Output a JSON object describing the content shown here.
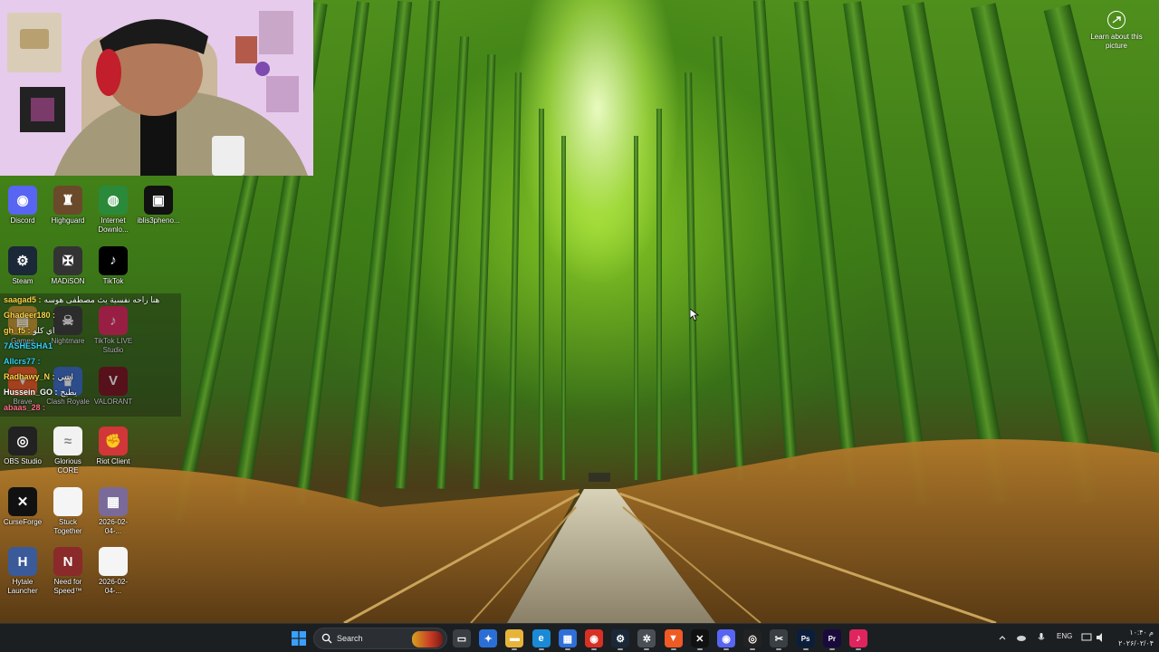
{
  "spotlight": {
    "label": "Learn about this picture"
  },
  "desktop": {
    "icons": [
      {
        "label": "Discord",
        "icon": "discord-icon",
        "color": "#5865f2",
        "glyph": "◉"
      },
      {
        "label": "Highguard",
        "icon": "highguard-icon",
        "color": "#6a4a2a",
        "glyph": "♜"
      },
      {
        "label": "Internet Downlo...",
        "icon": "internet-download-manager-icon",
        "color": "#2a8a3a",
        "glyph": "◍"
      },
      {
        "label": "iblis3pheno...",
        "icon": "file-thumbnail-icon",
        "color": "#111111",
        "glyph": "▣"
      },
      {
        "label": "Steam",
        "icon": "steam-icon",
        "color": "#1b2838",
        "glyph": "⚙"
      },
      {
        "label": "MADiSON",
        "icon": "madison-icon",
        "color": "#333333",
        "glyph": "✠"
      },
      {
        "label": "TikTok",
        "icon": "tiktok-icon",
        "color": "#000000",
        "glyph": "♪"
      },
      {
        "label": "Games",
        "icon": "games-folder-icon",
        "color": "#c79a2e",
        "glyph": "▤"
      },
      {
        "label": "Nightmare",
        "icon": "nightmare-icon",
        "color": "#3a3a3a",
        "glyph": "☠"
      },
      {
        "label": "TikTok LIVE Studio",
        "icon": "tiktok-live-studio-icon",
        "color": "#e0245e",
        "glyph": "♪"
      },
      {
        "label": "Brave",
        "icon": "brave-icon",
        "color": "#f05a24",
        "glyph": "▼"
      },
      {
        "label": "Clash Royale",
        "icon": "clash-royale-icon",
        "color": "#3a6bc9",
        "glyph": "♛"
      },
      {
        "label": "VALORANT",
        "icon": "valorant-icon",
        "color": "#7a1020",
        "glyph": "V"
      },
      {
        "label": "OBS Studio",
        "icon": "obs-studio-icon",
        "color": "#222222",
        "glyph": "◎"
      },
      {
        "label": "Glorious CORE",
        "icon": "glorious-core-icon",
        "color": "#f2f2f2",
        "glyph": "≈"
      },
      {
        "label": "Riot Client",
        "icon": "riot-client-icon",
        "color": "#d13639",
        "glyph": "✊"
      },
      {
        "label": "CurseForge",
        "icon": "curseforge-icon",
        "color": "#111111",
        "glyph": "✕"
      },
      {
        "label": "Stuck Together",
        "icon": "document-icon",
        "color": "#f5f5f5",
        "glyph": ""
      },
      {
        "label": "2026-02-04-...",
        "icon": "image-thumbnail-icon",
        "color": "#7a6a9a",
        "glyph": "▦"
      },
      {
        "label": "Hytale Launcher",
        "icon": "hytale-launcher-icon",
        "color": "#3a5a9a",
        "glyph": "H"
      },
      {
        "label": "Need for Speed™ Mo...",
        "icon": "need-for-speed-icon",
        "color": "#8a2a2a",
        "glyph": "N"
      },
      {
        "label": "2026-02-04-...",
        "icon": "document-icon",
        "color": "#f5f5f5",
        "glyph": ""
      }
    ]
  },
  "chat": [
    {
      "user": "saagad5 :",
      "message": "هنا راحه نفسية يث مصطفى هوسه",
      "color": "#ffd84a"
    },
    {
      "user": "Ghadeer180 :",
      "message": "",
      "color": "#ffd84a"
    },
    {
      "user": "gh_f5 :",
      "message": "اي كلو",
      "color": "#ffd84a"
    },
    {
      "user": "7ASHESHA1",
      "message": "",
      "color": "#35d3ff"
    },
    {
      "user": "Allcrs77 :",
      "message": "",
      "color": "#35d3ff"
    },
    {
      "user": "Radhawy_N :",
      "message": "اسي",
      "color": "#ffd84a"
    },
    {
      "user": "Hussein_GO :",
      "message": "يطيخ",
      "color": "#ffffff"
    },
    {
      "user": "abaas_28 :",
      "message": "",
      "color": "#ff6b8a"
    }
  ],
  "taskbar": {
    "search_label": "Search",
    "apps": [
      {
        "name": "task-view-icon",
        "color": "#3a3f44",
        "glyph": "▭"
      },
      {
        "name": "copilot-icon",
        "color": "#2b6fd6",
        "glyph": "✦"
      },
      {
        "name": "file-explorer-icon",
        "color": "#e7b43a",
        "glyph": "▬"
      },
      {
        "name": "edge-icon",
        "color": "#1b8ad6",
        "glyph": "e"
      },
      {
        "name": "microsoft-store-icon",
        "color": "#2f6fd8",
        "glyph": "▦"
      },
      {
        "name": "chrome-icon",
        "color": "#d93025",
        "glyph": "◉"
      },
      {
        "name": "steam-icon",
        "color": "#1b2838",
        "glyph": "⚙"
      },
      {
        "name": "settings-icon",
        "color": "#4a4f55",
        "glyph": "✲"
      },
      {
        "name": "brave-icon",
        "color": "#f05a24",
        "glyph": "▼"
      },
      {
        "name": "curseforge-icon",
        "color": "#111111",
        "glyph": "✕"
      },
      {
        "name": "discord-icon",
        "color": "#5865f2",
        "glyph": "◉"
      },
      {
        "name": "obs-studio-icon",
        "color": "#222222",
        "glyph": "◎"
      },
      {
        "name": "snipping-tool-icon",
        "color": "#3a3f44",
        "glyph": "✂"
      },
      {
        "name": "photoshop-icon",
        "color": "#0a1e3c",
        "glyph": "Ps"
      },
      {
        "name": "premiere-icon",
        "color": "#1a0a3c",
        "glyph": "Pr"
      },
      {
        "name": "tiktok-live-studio-icon",
        "color": "#e0245e",
        "glyph": "♪"
      }
    ],
    "language": "ENG",
    "clock_time": "۱۰:۴۰ م",
    "clock_date": "۲۰۲۶/۰۲/۰۴"
  }
}
